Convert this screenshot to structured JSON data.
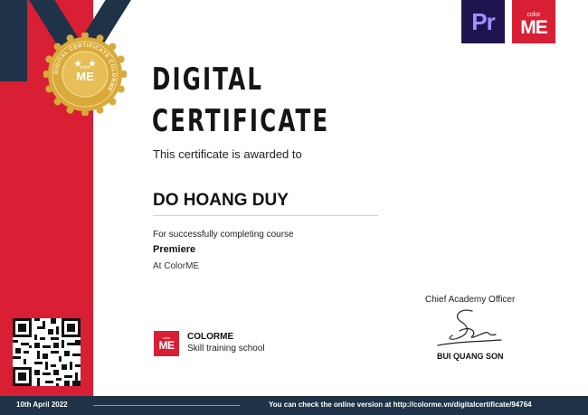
{
  "logos": {
    "premiere": "Pr",
    "colorme_small": "color",
    "colorme_big": "ME"
  },
  "seal": {
    "ring_text": "DIGITAL CERTIFICATE COLORME",
    "center_small": "color",
    "center_big": "ME"
  },
  "certificate": {
    "title_line1": "DIGITAL",
    "title_line2": "CERTIFICATE",
    "awarded_text": "This certificate is awarded to",
    "recipient": "DO HOANG DUY",
    "completion_text": "For successfully completing course",
    "course": "Premiere",
    "provider": "At ColorME"
  },
  "signer": {
    "role": "Chief Academy Officer",
    "name": "BUI QUANG SON"
  },
  "school": {
    "logo_small": "color",
    "logo_big": "ME",
    "name": "COLORME",
    "tagline": "Skill training school"
  },
  "footer": {
    "date": "10th April 2022",
    "note": "You can check the online version at http://colorme.vn/digitalcertificate/94764"
  },
  "colors": {
    "red": "#d81f34",
    "navy": "#1e3347",
    "gold": "#d9a93b",
    "premiere_bg": "#1f1450"
  }
}
